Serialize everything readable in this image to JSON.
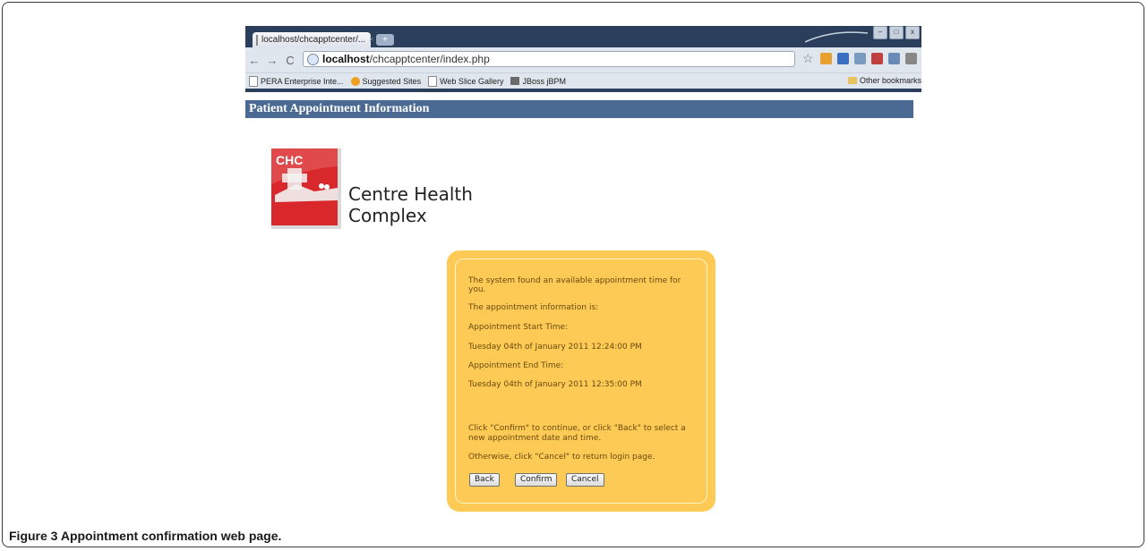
{
  "browser": {
    "tab_title": "localhost/chcapptcenter/...",
    "tab_close": "×",
    "url_host": "localhost",
    "url_path": "/chcapptcenter/index.php",
    "bookmarks": [
      {
        "label": "PERA Enterprise Inte...",
        "icon": "page-icon"
      },
      {
        "label": "Suggested Sites",
        "icon": "bulb-icon"
      },
      {
        "label": "Web Slice Gallery",
        "icon": "page-icon"
      },
      {
        "label": "JBoss jBPM",
        "icon": "jboss-icon"
      }
    ],
    "other_bookmarks": "Other bookmarks"
  },
  "page": {
    "header": "Patient Appointment Information",
    "logo_mark": "CHC",
    "logo_line1": "Centre Health",
    "logo_line2": "Complex"
  },
  "panel": {
    "found_line1": "The system found an available appointment time for",
    "found_line2": "you.",
    "info_intro": "The appointment information is:",
    "start_label": "Appointment Start Time:",
    "start_value": "Tuesday 04th of January 2011 12:24:00 PM",
    "end_label": "Appointment End Time:",
    "end_value": "Tuesday 04th of January 2011 12:35:00 PM",
    "instruction_line1": "Click \"Confirm\" to continue, or click \"Back\" to select a",
    "instruction_line2": "new appointment date and time.",
    "cancel_instruction": "Otherwise, click \"Cancel\" to return login page.",
    "back_label": "Back",
    "confirm_label": "Confirm",
    "cancel_label": "Cancel",
    "background_color": "#fdca55"
  },
  "caption": {
    "label": "Figure 3",
    "text": "Appointment confirmation web page."
  }
}
